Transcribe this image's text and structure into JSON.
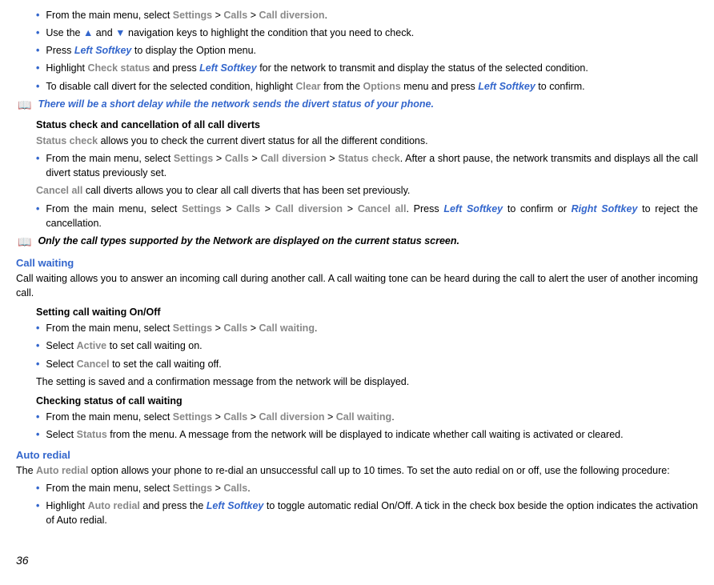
{
  "section1": {
    "b1_prefix": "From the main menu, select ",
    "b1_settings": "Settings",
    "b1_calls": "Calls",
    "b1_calldiversion": "Call diversion",
    "b2_prefix": "Use the ",
    "b2_and": " and ",
    "b2_suffix": " navigation keys to highlight  the condition that you need to check.",
    "b3_prefix": "Press ",
    "b3_softkey": "Left Softkey",
    "b3_suffix": "  to display the Option menu.",
    "b4_prefix": "Highlight ",
    "b4_checkstatus": "Check status",
    "b4_mid": " and press ",
    "b4_softkey": "Left Softkey",
    "b4_suffix": " for the network to transmit and display the status of the selected condition.",
    "b5_prefix": "To disable call divert for the selected condition, highlight ",
    "b5_clear": "Clear",
    "b5_from": " from the ",
    "b5_options": "Options ",
    "b5_menu": "menu and press ",
    "b5_softkey": "Left Softkey",
    "b5_suffix": " to confirm.",
    "note1": "There will be a short delay while the network sends the divert status of your phone."
  },
  "section2": {
    "heading": "Status check and cancellation of all call diverts",
    "line1_status": "Status check",
    "line1_suffix": " allows you to check the current divert status for all the different conditions.",
    "b1_prefix": "From the main menu, select ",
    "b1_settings": "Settings",
    "b1_calls": "Calls",
    "b1_calldiversion": "Call diversion",
    "b1_statuscheck": "Status check",
    "b1_suffix": ". After a short pause, the network transmits and displays all the call divert status previously set.",
    "line2_cancel": "Cancel all",
    "line2_suffix": " call diverts allows you to clear all call diverts that has been set previously.",
    "b2_prefix": "From the main menu, select ",
    "b2_settings": "Settings",
    "b2_calls": "Calls",
    "b2_calldiversion": "Call diversion",
    "b2_cancelall": "Cancel all",
    "b2_mid": ". Press ",
    "b2_leftsoftkey": "Left Softkey",
    "b2_confirm": " to confirm or ",
    "b2_rightsoftkey": "Right Softkey",
    "b2_suffix": " to reject the cancellation.",
    "note2": "Only the call types supported by the Network are displayed on the current status screen."
  },
  "callwaiting": {
    "heading": "Call waiting",
    "intro": "Call waiting allows you to answer an incoming call during another call. A call waiting tone can be heard during the call to alert the user of another incoming call.",
    "sub1_heading": "Setting call waiting On/Off",
    "b1_prefix": "From the main menu, select ",
    "b1_settings": "Settings",
    "b1_calls": "Calls",
    "b1_callwaiting": "Call waiting",
    "b2_prefix": "Select ",
    "b2_active": "Active",
    "b2_suffix": " to set call waiting on.",
    "b3_prefix": "Select ",
    "b3_cancel": "Cancel",
    "b3_suffix": " to set the call waiting off.",
    "line3": "The setting is saved and a confirmation message from the network will be displayed.",
    "sub2_heading": "Checking status of call waiting",
    "b4_prefix": "From the main menu, select ",
    "b4_settings": "Settings",
    "b4_calls": "Calls",
    "b4_calldiversion": "Call diversion",
    "b4_callwaiting": "Call waiting",
    "b5_prefix": "Select ",
    "b5_status": "Status",
    "b5_suffix": " from the menu. A message from the network will be displayed to indicate whether call waiting is activated or cleared."
  },
  "autoredial": {
    "heading": "Auto redial",
    "intro_prefix": "The ",
    "intro_auto": "Auto redial",
    "intro_suffix": " option allows your phone to re-dial an unsuccessful call up to 10 times. To set the auto redial on or off, use the following procedure:",
    "b1_prefix": "From the main menu, select ",
    "b1_settings": "Settings",
    "b1_calls": "Calls",
    "b2_prefix": "Highlight ",
    "b2_auto": "Auto redial",
    "b2_mid": " and press the ",
    "b2_softkey": "Left Softkey",
    "b2_suffix": " to toggle automatic redial On/Off. A tick in the check box beside the option indicates the activation of Auto redial."
  },
  "gt": " > ",
  "dot": ".",
  "page": "36"
}
